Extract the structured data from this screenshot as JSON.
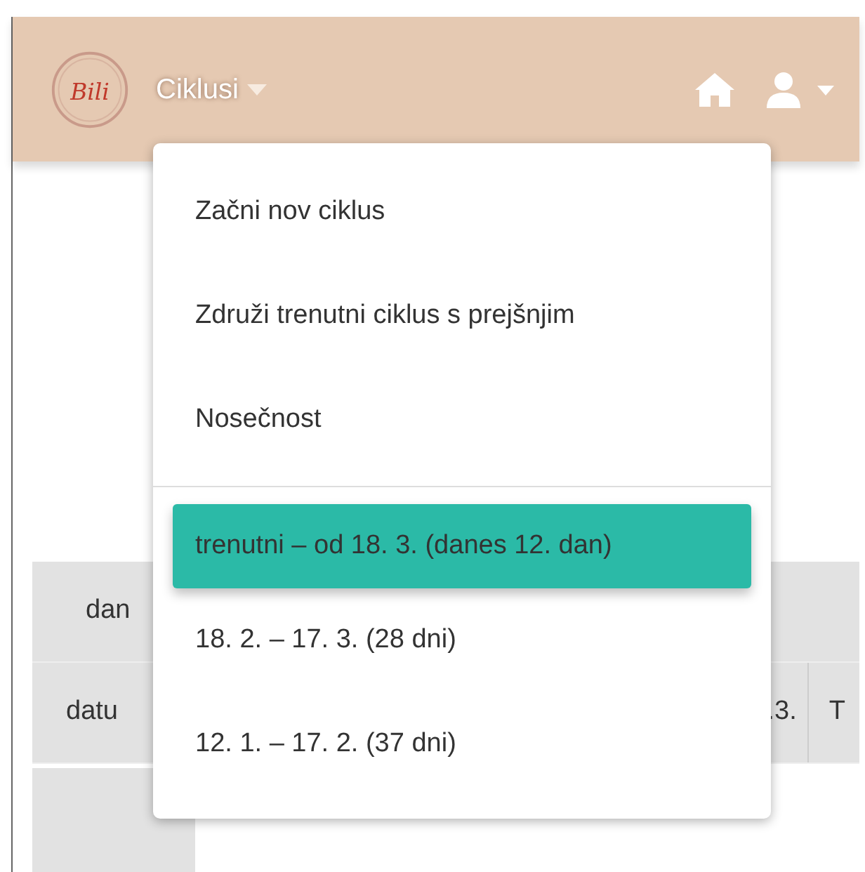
{
  "navbar": {
    "brand": "Bili",
    "menu_label": "Ciklusi"
  },
  "dropdown": {
    "actions": [
      "Začni nov ciklus",
      "Združi trenutni ciklus s prejšnjim",
      "Nosečnost"
    ],
    "cycles": [
      {
        "label": "trenutni – od 18. 3. (danes 12. dan)",
        "selected": true
      },
      {
        "label": "18. 2. – 17. 3. (28 dni)",
        "selected": false
      },
      {
        "label": "12. 1. – 17. 2. (37 dni)",
        "selected": false
      }
    ]
  },
  "table": {
    "row_1": [
      "dan"
    ],
    "row_2": [
      "datu",
      ".3.",
      "T"
    ]
  }
}
